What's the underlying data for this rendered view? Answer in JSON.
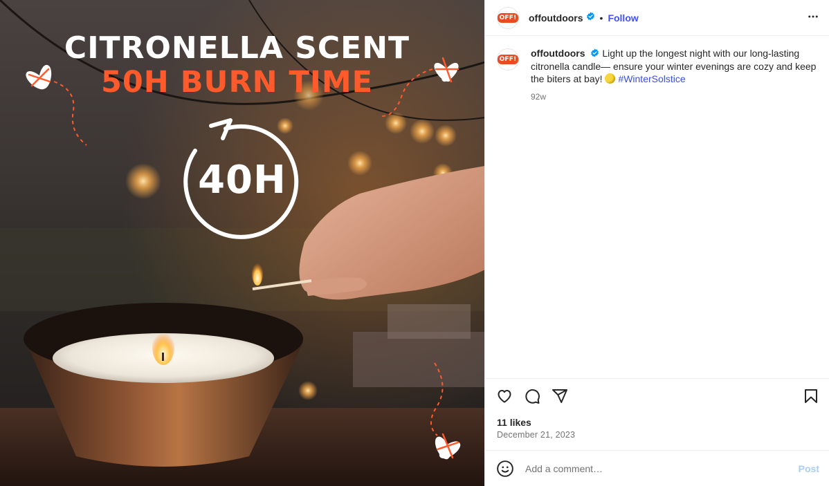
{
  "media": {
    "headline_line1": "CITRONELLA SCENT",
    "headline_line2": "50H BURN TIME",
    "timer_label": "40H",
    "accent_color": "#ff5a2b"
  },
  "header": {
    "logo_text": "OFF!",
    "username": "offoutdoors",
    "verified_icon": "verified-badge-icon",
    "separator": "•",
    "follow_label": "Follow",
    "more_icon": "more-options-icon"
  },
  "caption": {
    "username": "offoutdoors",
    "text": "Light up the longest night with our long-lasting citronella candle— ensure your winter evenings are cozy and keep the biters at bay!",
    "emoji_icon": "moon-icon",
    "hashtag": "#WinterSolstice",
    "time": "92w"
  },
  "actions": {
    "like_icon": "heart-icon",
    "comment_icon": "comment-icon",
    "share_icon": "share-icon",
    "save_icon": "bookmark-icon"
  },
  "likes": "11 likes",
  "date": "December 21, 2023",
  "comment_box": {
    "emoji_icon": "smiley-icon",
    "placeholder": "Add a comment…",
    "post_label": "Post"
  },
  "colors": {
    "link": "#4150f7",
    "follow": "#4150f7",
    "post_disabled": "#a9cdf5",
    "brand": "#ec4b22"
  }
}
